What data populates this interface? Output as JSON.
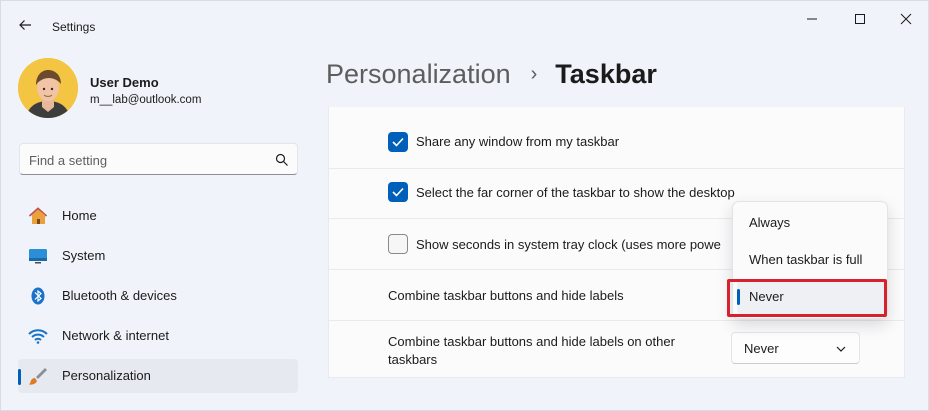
{
  "window": {
    "title": "Settings",
    "controls": {
      "minimize_icon": "minimize-icon",
      "maximize_icon": "maximize-icon",
      "close_icon": "close-icon"
    }
  },
  "user": {
    "name": "User Demo",
    "email": "m__lab@outlook.com"
  },
  "search": {
    "placeholder": "Find a setting"
  },
  "sidebar": {
    "items": [
      {
        "label": "Home",
        "icon": "home-icon"
      },
      {
        "label": "System",
        "icon": "system-icon"
      },
      {
        "label": "Bluetooth & devices",
        "icon": "bluetooth-icon"
      },
      {
        "label": "Network & internet",
        "icon": "wifi-icon"
      },
      {
        "label": "Personalization",
        "icon": "brush-icon",
        "active": true
      }
    ]
  },
  "breadcrumb": {
    "parent": "Personalization",
    "separator": "›",
    "current": "Taskbar"
  },
  "settings": {
    "share_window": {
      "label": "Share any window from my taskbar",
      "checked": true
    },
    "far_corner": {
      "label": "Select the far corner of the taskbar to show the desktop",
      "checked": true
    },
    "show_seconds": {
      "label": "Show seconds in system tray clock (uses more powe",
      "checked": false
    },
    "combine_buttons": {
      "label": "Combine taskbar buttons and hide labels"
    },
    "combine_other": {
      "label_line1": "Combine taskbar buttons and hide labels on other",
      "label_line2": "taskbars",
      "value": "Never"
    }
  },
  "dropdown": {
    "options": [
      "Always",
      "When taskbar is full",
      "Never"
    ],
    "selected": "Never"
  },
  "colors": {
    "accent": "#005fb8",
    "highlight": "#d6222c"
  }
}
